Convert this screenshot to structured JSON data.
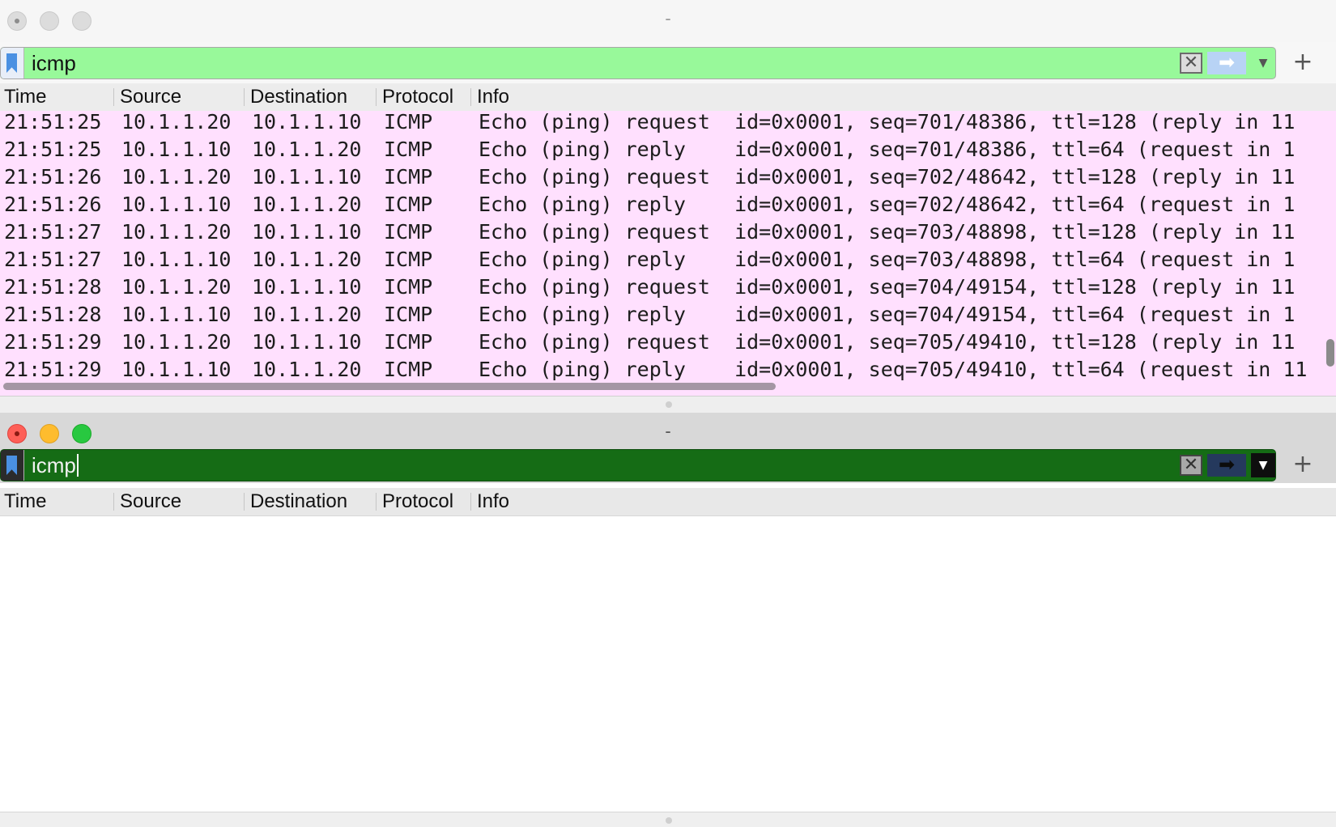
{
  "windows": [
    {
      "title": "-",
      "filter": {
        "value": "icmp",
        "bookmark_icon": "bookmark-icon",
        "clear_icon": "clear-x-icon",
        "apply_icon": "arrow-right-icon",
        "dropdown_icon": "chevron-down-icon",
        "add_icon": "plus-icon",
        "status_color": "#98f99a"
      },
      "columns": [
        "Time",
        "Source",
        "Destination",
        "Protocol",
        "Info"
      ],
      "row_color": "#ffe0fe",
      "rows": [
        {
          "time": "21:51:25",
          "source": "10.1.1.20",
          "destination": "10.1.1.10",
          "protocol": "ICMP",
          "info": "Echo (ping) request  id=0x0001, seq=701/48386, ttl=128 (reply in 11"
        },
        {
          "time": "21:51:25",
          "source": "10.1.1.10",
          "destination": "10.1.1.20",
          "protocol": "ICMP",
          "info": "Echo (ping) reply    id=0x0001, seq=701/48386, ttl=64 (request in 1"
        },
        {
          "time": "21:51:26",
          "source": "10.1.1.20",
          "destination": "10.1.1.10",
          "protocol": "ICMP",
          "info": "Echo (ping) request  id=0x0001, seq=702/48642, ttl=128 (reply in 11"
        },
        {
          "time": "21:51:26",
          "source": "10.1.1.10",
          "destination": "10.1.1.20",
          "protocol": "ICMP",
          "info": "Echo (ping) reply    id=0x0001, seq=702/48642, ttl=64 (request in 1"
        },
        {
          "time": "21:51:27",
          "source": "10.1.1.20",
          "destination": "10.1.1.10",
          "protocol": "ICMP",
          "info": "Echo (ping) request  id=0x0001, seq=703/48898, ttl=128 (reply in 11"
        },
        {
          "time": "21:51:27",
          "source": "10.1.1.10",
          "destination": "10.1.1.20",
          "protocol": "ICMP",
          "info": "Echo (ping) reply    id=0x0001, seq=703/48898, ttl=64 (request in 1"
        },
        {
          "time": "21:51:28",
          "source": "10.1.1.20",
          "destination": "10.1.1.10",
          "protocol": "ICMP",
          "info": "Echo (ping) request  id=0x0001, seq=704/49154, ttl=128 (reply in 11"
        },
        {
          "time": "21:51:28",
          "source": "10.1.1.10",
          "destination": "10.1.1.20",
          "protocol": "ICMP",
          "info": "Echo (ping) reply    id=0x0001, seq=704/49154, ttl=64 (request in 1"
        },
        {
          "time": "21:51:29",
          "source": "10.1.1.20",
          "destination": "10.1.1.10",
          "protocol": "ICMP",
          "info": "Echo (ping) request  id=0x0001, seq=705/49410, ttl=128 (reply in 11"
        },
        {
          "time": "21:51:29",
          "source": "10.1.1.10",
          "destination": "10.1.1.20",
          "protocol": "ICMP",
          "info": "Echo (ping) reply    id=0x0001, seq=705/49410, ttl=64 (request in 11"
        }
      ]
    },
    {
      "title": "-",
      "filter": {
        "value": "icmp",
        "bookmark_icon": "bookmark-icon",
        "clear_icon": "clear-x-icon",
        "apply_icon": "arrow-right-icon",
        "dropdown_icon": "chevron-down-icon",
        "add_icon": "plus-icon",
        "status_color": "#156c15"
      },
      "columns": [
        "Time",
        "Source",
        "Destination",
        "Protocol",
        "Info"
      ],
      "rows": []
    }
  ]
}
